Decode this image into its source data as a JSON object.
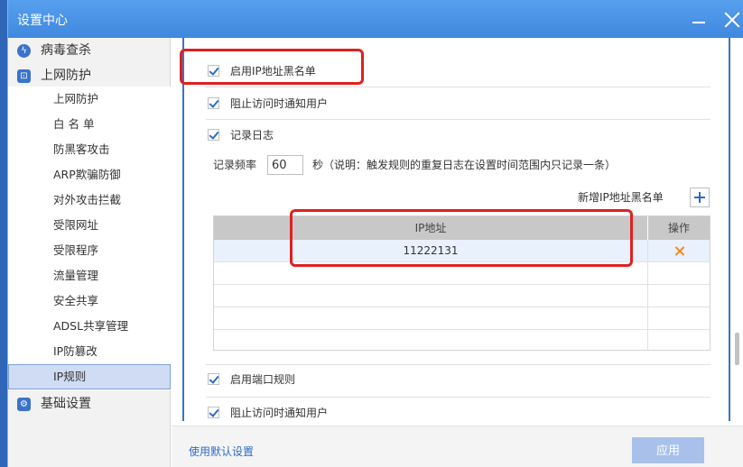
{
  "window": {
    "title": "设置中心"
  },
  "sidebar": {
    "groups": [
      {
        "label": "病毒查杀",
        "icon": "virus-scan-icon"
      },
      {
        "label": "上网防护",
        "icon": "web-protection-icon"
      },
      {
        "label": "基础设置",
        "icon": "settings-icon"
      }
    ],
    "items": [
      {
        "label": "上网防护"
      },
      {
        "label": "白 名 单"
      },
      {
        "label": "防黑客攻击"
      },
      {
        "label": "ARP欺骗防御"
      },
      {
        "label": "对外攻击拦截"
      },
      {
        "label": "受限网址"
      },
      {
        "label": "受限程序"
      },
      {
        "label": "流量管理"
      },
      {
        "label": "安全共享"
      },
      {
        "label": "ADSL共享管理"
      },
      {
        "label": "IP防篡改"
      },
      {
        "label": "IP规则"
      }
    ],
    "active_item": "IP规则"
  },
  "main": {
    "enable_ip_blacklist": "启用IP地址黑名单",
    "notify_user_1": "阻止访问时通知用户",
    "record_log": "记录日志",
    "freq_label": "记录频率",
    "freq_value": "60",
    "freq_unit": "秒（说明：触发规则的重复日志在设置时间范围内只记录一条）",
    "add_blacklist_label": "新增IP地址黑名单",
    "table": {
      "headers": {
        "ip": "IP地址",
        "op": "操作"
      },
      "rows": [
        {
          "ip": "11222131"
        }
      ]
    },
    "enable_port_rule": "启用端口规则",
    "notify_user_2": "阻止访问时通知用户"
  },
  "footer": {
    "default_link": "使用默认设置",
    "apply_label": "应用"
  },
  "colors": {
    "accent": "#3a73c9",
    "titlebar": "#4a90e2",
    "highlight": "#e02020",
    "delete": "#f08a1c"
  }
}
